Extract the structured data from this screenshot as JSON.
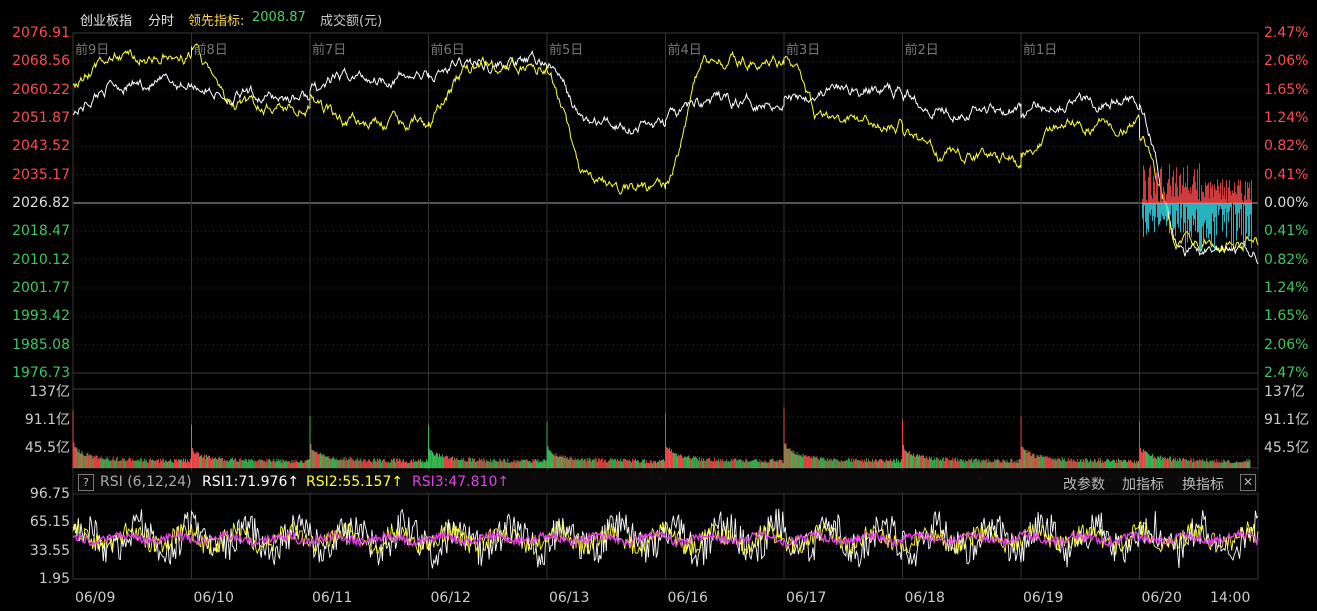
{
  "header": {
    "index_name": "创业板指",
    "mode": "分时",
    "leading_label": "领先指标:",
    "leading_value": "2008.87",
    "amount_label": "成交额(元)"
  },
  "price_axis": {
    "left_labels": [
      "2076.91",
      "2068.56",
      "2060.22",
      "2051.87",
      "2043.52",
      "2035.17",
      "2026.82",
      "2018.47",
      "2010.12",
      "2001.77",
      "1993.42",
      "1985.08",
      "1976.73"
    ],
    "right_labels": [
      "2.47%",
      "2.06%",
      "1.65%",
      "1.24%",
      "0.82%",
      "0.41%",
      "0.00%",
      "0.41%",
      "0.82%",
      "1.24%",
      "1.65%",
      "2.06%",
      "2.47%"
    ],
    "baseline_index": 6
  },
  "day_labels": [
    "前9日",
    "前8日",
    "前7日",
    "前6日",
    "前5日",
    "前4日",
    "前3日",
    "前2日",
    "前1日"
  ],
  "volume_axis": {
    "labels": [
      "137亿",
      "91.1亿",
      "45.5亿"
    ]
  },
  "rsi_panel": {
    "help_symbol": "?",
    "name": "RSI (6,12,24)",
    "rsi1": "RSI1:71.976↑",
    "rsi2": "RSI2:55.157↑",
    "rsi3": "RSI3:47.810↑",
    "buttons": [
      "改参数",
      "加指标",
      "换指标"
    ],
    "close_symbol": "✕",
    "labels": [
      "96.75",
      "65.15",
      "33.55",
      "1.95"
    ]
  },
  "date_labels": [
    "06/09",
    "06/10",
    "06/11",
    "06/12",
    "06/13",
    "06/16",
    "06/17",
    "06/18",
    "06/19",
    "06/20",
    "14:00"
  ],
  "colors": {
    "up": "#ff4b4b",
    "down": "#3cc85a",
    "white_line": "#ffffff",
    "yellow_line": "#ffff33",
    "magenta_line": "#e040e0",
    "cyan_bar": "#33e0f0",
    "grid": "#333333",
    "leading_value": "#ffd84a"
  },
  "chart_data": [
    {
      "type": "line",
      "title": "创业板指",
      "x": [
        "06/09",
        "06/10",
        "06/11",
        "06/12",
        "06/13",
        "06/16",
        "06/17",
        "06/18",
        "06/19",
        "06/20"
      ],
      "series": [
        {
          "values": [
            2062,
            2058,
            2064,
            2068,
            2050,
            2057,
            2060,
            2055,
            2057,
            2012
          ]
        },
        {
          "values": [
            2070,
            2055,
            2050,
            2067,
            2032,
            2069,
            2050,
            2040,
            2050,
            2015
          ]
        }
      ],
      "ylim": [
        1976.73,
        2076.91
      ]
    },
    {
      "type": "bar",
      "title": "成交额(元)",
      "categories": [
        "06/09",
        "06/10",
        "06/11",
        "06/12",
        "06/13",
        "06/16",
        "06/17",
        "06/18",
        "06/19",
        "06/20"
      ],
      "values": [
        100,
        75,
        90,
        75,
        80,
        95,
        105,
        85,
        90,
        80
      ],
      "ylim": [
        0,
        137
      ]
    },
    {
      "type": "line",
      "title": "RSI (6,12,24)",
      "series": [
        {
          "name": "RSI1",
          "values": [
            71.976
          ]
        },
        {
          "name": "RSI2",
          "values": [
            55.157
          ]
        },
        {
          "name": "RSI3",
          "values": [
            47.81
          ]
        }
      ],
      "ylim": [
        1.95,
        96.75
      ]
    }
  ]
}
